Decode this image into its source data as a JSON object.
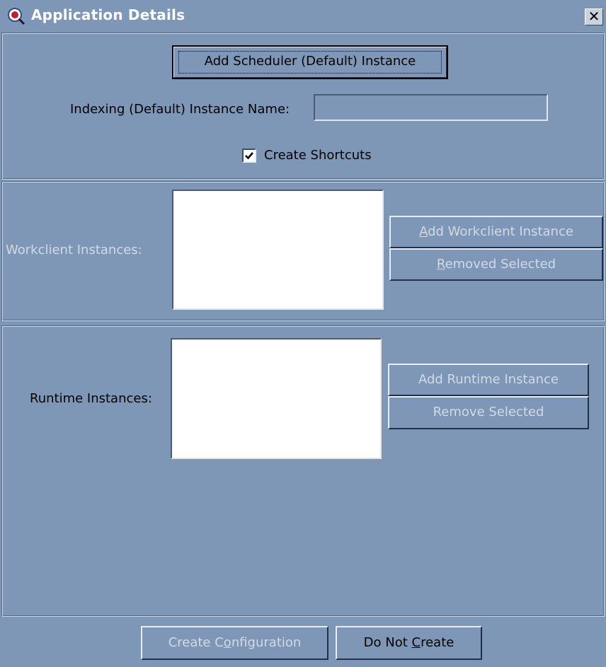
{
  "window": {
    "title": "Application Details",
    "close_glyph": "✕",
    "icon": "magnifier-app-icon"
  },
  "top_section": {
    "add_scheduler_button": "Add Scheduler (Default) Instance",
    "indexing_label": "Indexing (Default) Instance Name:",
    "indexing_value": "",
    "create_shortcuts_label": "Create Shortcuts",
    "create_shortcuts_checked": true
  },
  "workclient_section": {
    "label": "Workclient Instances:",
    "items": [],
    "add_button": {
      "mnemonic": "A",
      "rest": "dd Workclient Instance"
    },
    "remove_button": {
      "mnemonic": "R",
      "rest": "emoved Selected"
    }
  },
  "runtime_section": {
    "label": "Runtime Instances:",
    "items": [],
    "add_button": "Add Runtime Instance",
    "remove_button": "Remove Selected"
  },
  "footer": {
    "create_config_button": {
      "pre": "Create C",
      "mnemonic": "o",
      "post": "nfiguration"
    },
    "do_not_create_button": {
      "pre": "Do Not ",
      "mnemonic": "C",
      "post": "reate"
    }
  },
  "colors": {
    "background": "#7e97b6",
    "disabled_text": "#d1dae5",
    "title_text": "#ffffff"
  }
}
